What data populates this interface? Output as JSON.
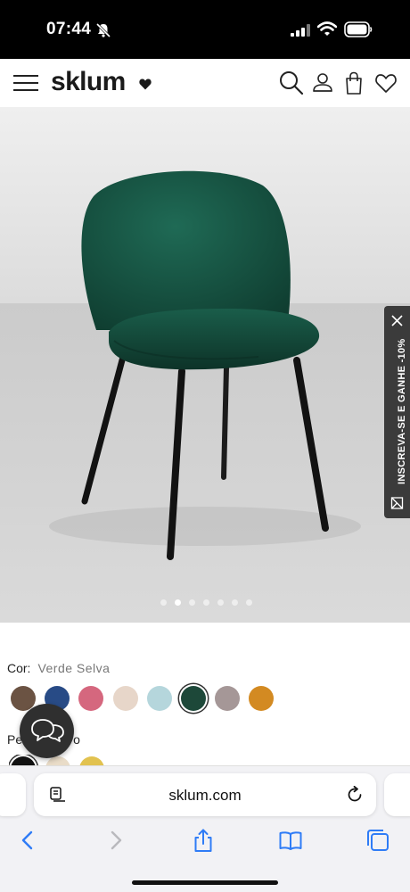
{
  "status_bar": {
    "time": "07:44",
    "icons": [
      "bell-slash-icon",
      "signal-icon",
      "wifi-icon",
      "battery-icon"
    ]
  },
  "header": {
    "logo_text": "sklum",
    "icons": [
      "menu-icon",
      "search-icon",
      "account-icon",
      "cart-icon",
      "wishlist-heart-icon"
    ]
  },
  "gallery": {
    "image": "green-velvet-chair-photo",
    "dot_count": 7,
    "active_index": 1
  },
  "newsletter_tab": {
    "text": "INSCREVA-SE E GANHE -10%",
    "icons": [
      "close-icon",
      "mail-icon"
    ]
  },
  "product_options": {
    "color_label": "Cor:",
    "color_value": "Verde Selva",
    "color_swatches": [
      {
        "name": "brown",
        "color": "#6b5343"
      },
      {
        "name": "blue",
        "color": "#284b86"
      },
      {
        "name": "pink",
        "color": "#d5677e"
      },
      {
        "name": "beige",
        "color": "#e7d6c9"
      },
      {
        "name": "light-blue",
        "color": "#b5d6dc"
      },
      {
        "name": "green",
        "color": "#1d4839"
      },
      {
        "name": "grey",
        "color": "#a59797"
      },
      {
        "name": "mustard",
        "color": "#d38a22"
      }
    ],
    "selected_color_index": 5,
    "legs_label_visible_start": "Pe",
    "legs_label_visible_end": "o",
    "legs_swatches": [
      {
        "name": "black",
        "color": "#111111"
      },
      {
        "name": "natural-wood",
        "color": "#e9dcc8"
      },
      {
        "name": "gold",
        "color": "#e2c24f"
      }
    ]
  },
  "chat": {
    "icon": "chat-bubbles-icon"
  },
  "safari": {
    "url": "sklum.com",
    "icons": [
      "reader-icon",
      "reload-icon",
      "back-icon",
      "forward-icon",
      "share-icon",
      "bookmarks-icon",
      "tabs-icon"
    ]
  },
  "colors": {
    "accent_blue": "#2f7cf6",
    "tab_grey": "#3b3b3b",
    "selected_green": "#1d4839"
  }
}
